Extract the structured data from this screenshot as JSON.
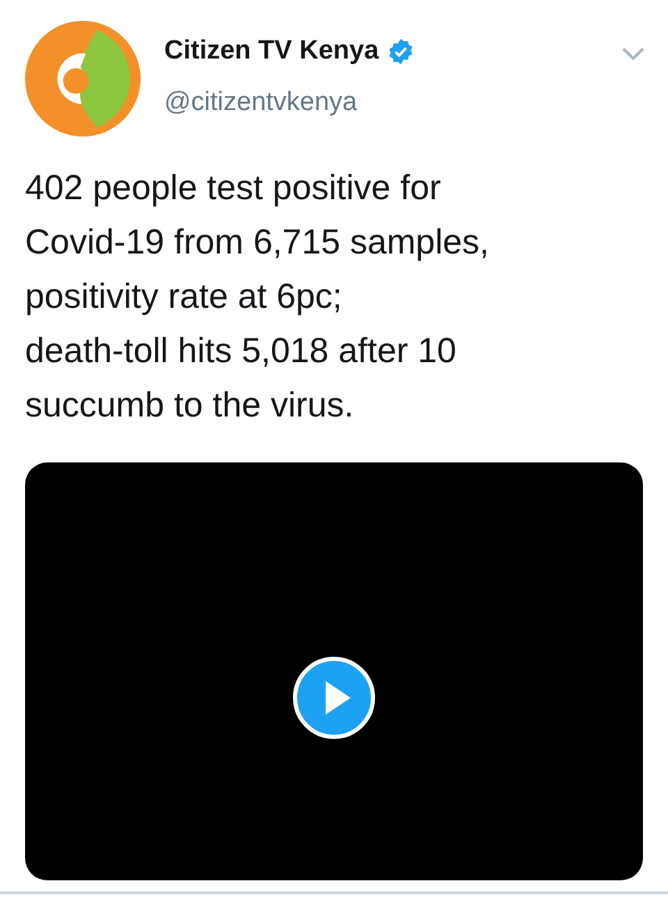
{
  "tweet": {
    "author": {
      "name": "Citizen TV Kenya",
      "verified": true,
      "handle": "@citizentvkenya"
    },
    "text": "402 people test positive for\nCovid-19 from 6,715 samples,\npositivity rate at 6pc;\ndeath-toll hits 5,018 after 10\nsuccumb to the virus.",
    "media": {
      "kind": "video"
    }
  }
}
